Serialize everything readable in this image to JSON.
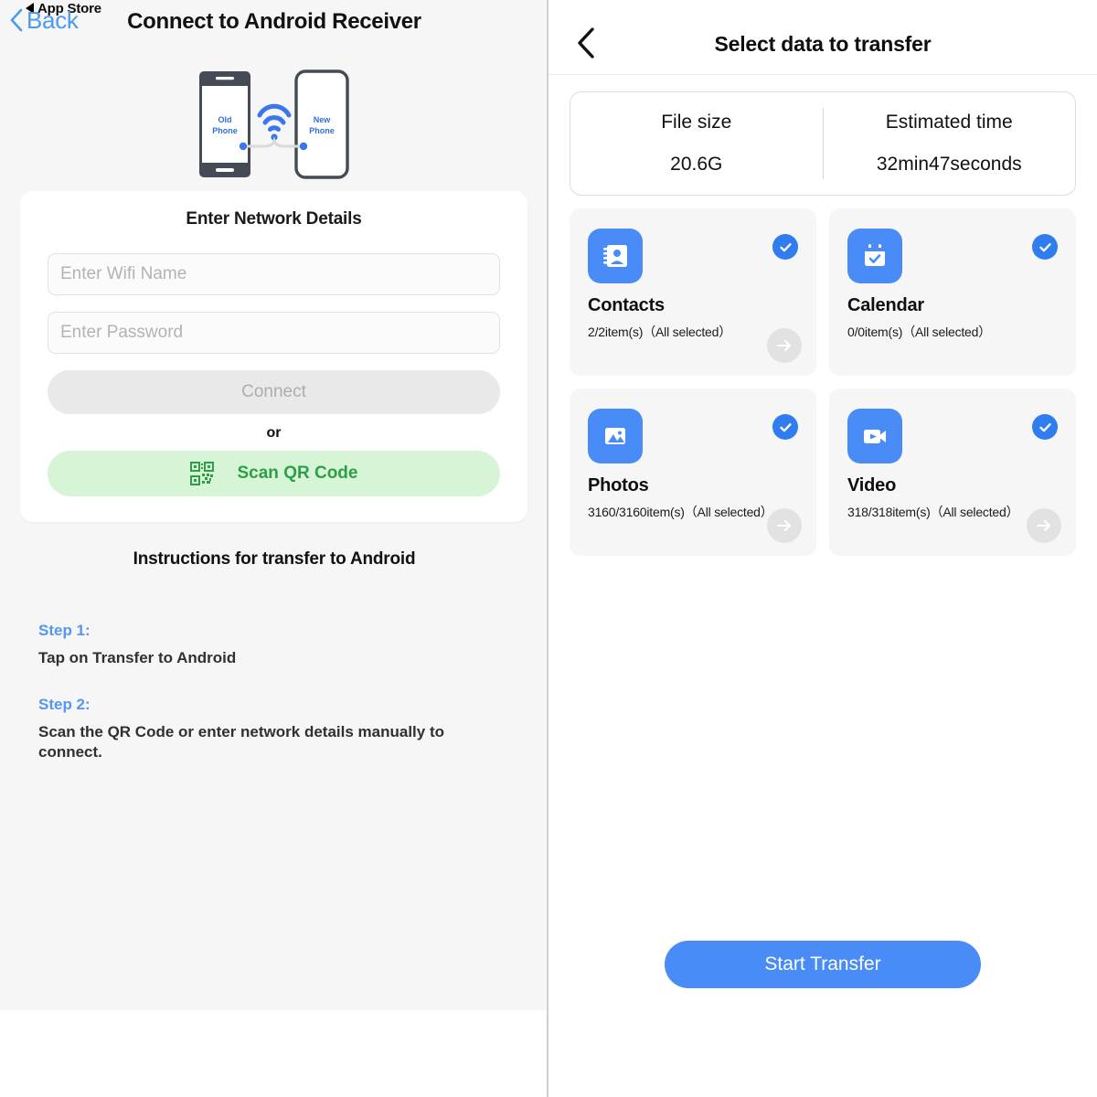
{
  "left": {
    "nav": {
      "app_store_label": "App Store",
      "back_label": "Back"
    },
    "title": "Connect to Android Receiver",
    "illustration": {
      "old_phone_line1": "Old",
      "old_phone_line2": "Phone",
      "new_phone_line1": "New",
      "new_phone_line2": "Phone"
    },
    "form": {
      "heading": "Enter Network Details",
      "wifi_placeholder": "Enter Wifi Name",
      "wifi_value": "",
      "password_placeholder": "Enter Password",
      "password_value": "",
      "connect_label": "Connect",
      "or_label": "or",
      "scan_qr_label": "Scan QR Code"
    },
    "instructions": {
      "heading": "Instructions for transfer to Android",
      "steps": [
        {
          "label": "Step 1:",
          "text": "Tap on Transfer to Android"
        },
        {
          "label": "Step 2:",
          "text": "Scan the QR Code or enter network details manually to connect."
        }
      ]
    }
  },
  "right": {
    "title": "Select data to transfer",
    "summary": {
      "file_size_label": "File size",
      "file_size_value": "20.6G",
      "estimated_time_label": "Estimated time",
      "estimated_time_value": "32min47seconds"
    },
    "items": [
      {
        "name": "Contacts",
        "meta": "2/2item(s)（All selected）",
        "icon": "contacts-icon",
        "selected": true,
        "has_arrow": true
      },
      {
        "name": "Calendar",
        "meta": "0/0item(s)（All selected）",
        "icon": "calendar-icon",
        "selected": true,
        "has_arrow": false
      },
      {
        "name": "Photos",
        "meta": "3160/3160item(s)（All selected）",
        "icon": "photos-icon",
        "selected": true,
        "has_arrow": true
      },
      {
        "name": "Video",
        "meta": "318/318item(s)（All selected）",
        "icon": "video-icon",
        "selected": true,
        "has_arrow": true
      }
    ],
    "start_transfer_label": "Start Transfer"
  },
  "colors": {
    "accent_blue": "#4a8cf7",
    "check_blue": "#2f7def",
    "link_blue": "#4a9bf0",
    "step_blue": "#5596ef",
    "qr_green_bg": "#d6f5d6",
    "qr_green_text": "#2e9e47",
    "page_gray": "#f6f6f6"
  }
}
